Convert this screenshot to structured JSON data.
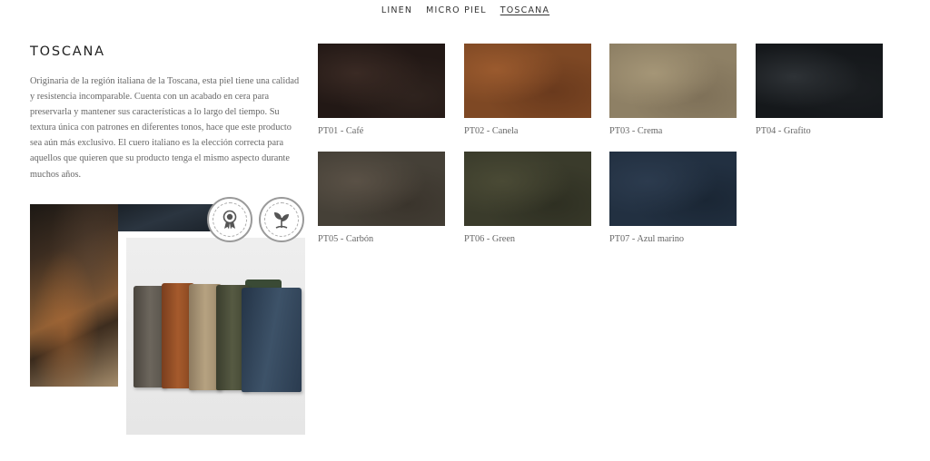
{
  "tabs": [
    {
      "label": "LINEN"
    },
    {
      "label": "MICRO PIEL"
    },
    {
      "label": "TOSCANA",
      "active": true
    }
  ],
  "collection": {
    "title": "TOSCANA",
    "description": "Originaria de la región italiana de la Toscana, esta piel tiene una calidad y resistencia incomparable. Cuenta con un acabado en cera para preservarla y mantener sus características a lo largo del tiempo. Su textura única con patrones en diferentes tonos, hace que este producto sea aún más exclusivo. El cuero italiano es la elección correcta para aquellos que quieren que su producto tenga el mismo aspecto durante muchos años."
  },
  "badges": [
    {
      "icon": "award-ribbon-icon"
    },
    {
      "icon": "eco-plant-icon"
    }
  ],
  "swatches": [
    {
      "label": "PT01 - Café",
      "color": "#221815"
    },
    {
      "label": "PT02 - Canela",
      "color": "#7e4824"
    },
    {
      "label": "PT03 - Crema",
      "color": "#8e8065"
    },
    {
      "label": "PT04 - Grafito",
      "color": "#15181b"
    },
    {
      "label": "PT05 - Carbón",
      "color": "#454037"
    },
    {
      "label": "PT06 - Green",
      "color": "#3a3b2b"
    },
    {
      "label": "PT07 - Azul marino",
      "color": "#223041"
    }
  ]
}
